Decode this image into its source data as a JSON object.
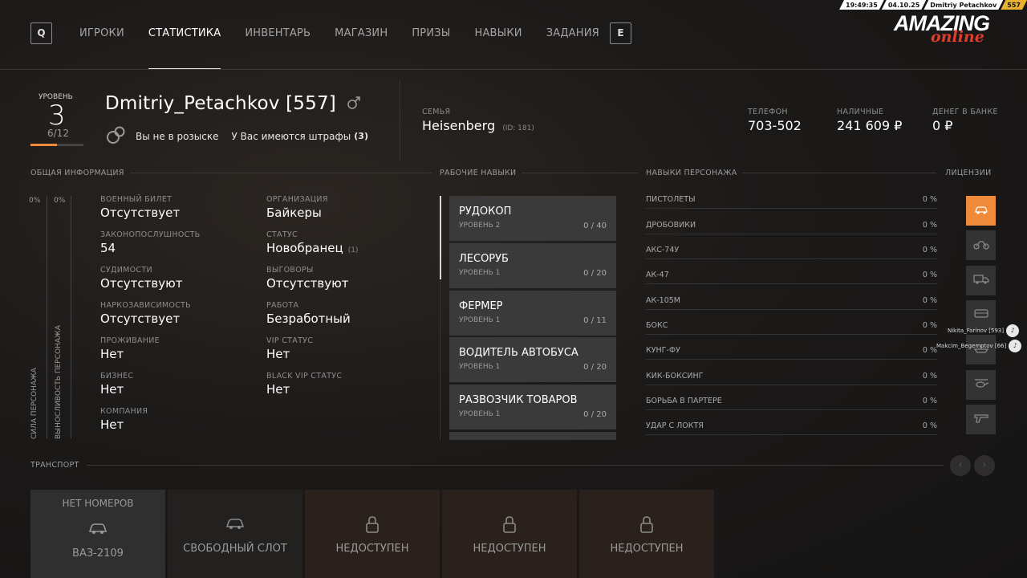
{
  "status_strip": {
    "time": "19:49:35",
    "date": "04.10.25",
    "player": "Dmitriy Petachkov",
    "id": "557"
  },
  "nav": {
    "left_key": "Q",
    "right_key": "E",
    "tabs": [
      "ИГРОКИ",
      "СТАТИСТИКА",
      "ИНВЕНТАРЬ",
      "МАГАЗИН",
      "ПРИЗЫ",
      "НАВЫКИ",
      "ЗАДАНИЯ"
    ],
    "active_tab": "СТАТИСТИКА"
  },
  "logo": {
    "main": "AMAZING",
    "sub": "online"
  },
  "player": {
    "level_label": "УРОВЕНЬ",
    "level": "3",
    "level_progress": "6/12",
    "level_fraction": 0.5,
    "name": "Dmitriy_Petachkov [557]",
    "gender_icon": "male-icon",
    "wanted": "Вы не в розыске",
    "fines_text": "У Вас имеются штрафы",
    "fines_count": "(3)"
  },
  "family": {
    "label": "СЕМЬЯ",
    "name": "Heisenberg",
    "id": "(ID: 181)"
  },
  "phone": {
    "label": "ТЕЛЕФОН",
    "value": "703-502"
  },
  "cash": {
    "label": "НАЛИЧНЫЕ",
    "value": "241 609 ₽"
  },
  "bank": {
    "label": "ДЕНЕГ В БАНКЕ",
    "value": "0 ₽"
  },
  "sections": {
    "general": "ОБЩАЯ ИНФОРМАЦИЯ",
    "jobs": "РАБОЧИЕ НАВЫКИ",
    "skills": "НАВЫКИ ПЕРСОНАЖА",
    "licenses": "ЛИЦЕНЗИИ",
    "transport": "ТРАНСПОРТ"
  },
  "stats_bars": {
    "strength_label": "СИЛА ПЕРСОНАЖА",
    "strength_value": "0%",
    "stamina_label": "ВЫНОСЛИВОСТЬ ПЕРСОНАЖА",
    "stamina_value": "0%"
  },
  "info_left": [
    {
      "label": "ВОЕННЫЙ БИЛЕТ",
      "value": "Отсутствует"
    },
    {
      "label": "ЗАКОНОПОСЛУШНОСТЬ",
      "value": "54"
    },
    {
      "label": "СУДИМОСТИ",
      "value": "Отсутствуют"
    },
    {
      "label": "НАРКОЗАВИСИМОСТЬ",
      "value": "Отсутствует"
    },
    {
      "label": "ПРОЖИВАНИЕ",
      "value": "Нет"
    },
    {
      "label": "БИЗНЕС",
      "value": "Нет"
    },
    {
      "label": "КОМПАНИЯ",
      "value": "Нет"
    }
  ],
  "info_right": [
    {
      "label": "ОРГАНИЗАЦИЯ",
      "value": "Байкеры",
      "extra": ""
    },
    {
      "label": "СТАТУС",
      "value": "Новобранец",
      "extra": "(1)"
    },
    {
      "label": "ВЫГОВОРЫ",
      "value": "Отсутствуют",
      "extra": ""
    },
    {
      "label": "РАБОТА",
      "value": "Безработный",
      "extra": ""
    },
    {
      "label": "VIP СТАТУС",
      "value": "Нет",
      "extra": ""
    },
    {
      "label": "BLACK VIP СТАТУС",
      "value": "Нет",
      "extra": ""
    }
  ],
  "jobs": [
    {
      "title": "РУДОКОП",
      "level": "УРОВЕНЬ 2",
      "progress": "0 / 40"
    },
    {
      "title": "ЛЕСОРУБ",
      "level": "УРОВЕНЬ 1",
      "progress": "0 / 20"
    },
    {
      "title": "ФЕРМЕР",
      "level": "УРОВЕНЬ 1",
      "progress": "0 / 11"
    },
    {
      "title": "ВОДИТЕЛЬ АВТОБУСА",
      "level": "УРОВЕНЬ 1",
      "progress": "0 / 20"
    },
    {
      "title": "РАЗВОЗЧИК ТОВАРОВ",
      "level": "УРОВЕНЬ 1",
      "progress": "0 / 20"
    }
  ],
  "skills": [
    {
      "name": "ПИСТОЛЕТЫ",
      "value": "0 %"
    },
    {
      "name": "ДРОБОВИКИ",
      "value": "0 %"
    },
    {
      "name": "АКС-74У",
      "value": "0 %"
    },
    {
      "name": "АК-47",
      "value": "0 %"
    },
    {
      "name": "АК-105М",
      "value": "0 %"
    },
    {
      "name": "БОКС",
      "value": "0 %"
    },
    {
      "name": "КУНГ-ФУ",
      "value": "0 %"
    },
    {
      "name": "КИК-БОКСИНГ",
      "value": "0 %"
    },
    {
      "name": "БОРЬБА В ПАРТЕРЕ",
      "value": "0 %"
    },
    {
      "name": "УДАР С ЛОКТЯ",
      "value": "0 %"
    }
  ],
  "licenses": [
    "car-icon",
    "motorcycle-icon",
    "truck-icon",
    "bus-icon",
    "boat-icon",
    "helicopter-icon",
    "gun-icon"
  ],
  "voice_chat": [
    {
      "name": "Nikita_Farinov [593]"
    },
    {
      "name": "Makcim_Begemotov [66]"
    }
  ],
  "transport": [
    {
      "top": "НЕТ НОМЕРОВ",
      "label": "ВАЗ-2109",
      "icon": "car-icon"
    },
    {
      "top": "",
      "label": "СВОБОДНЫЙ СЛОТ",
      "icon": "car-icon"
    },
    {
      "top": "",
      "label": "НЕДОСТУПЕН",
      "icon": "lock-icon"
    },
    {
      "top": "",
      "label": "НЕДОСТУПЕН",
      "icon": "lock-icon"
    },
    {
      "top": "",
      "label": "НЕДОСТУПЕН",
      "icon": "lock-icon"
    }
  ],
  "colors": {
    "accent": "#ef8a3a",
    "card": "#3a3a3a",
    "logo_red": "#e23c2c",
    "gold": "#e8b230"
  }
}
